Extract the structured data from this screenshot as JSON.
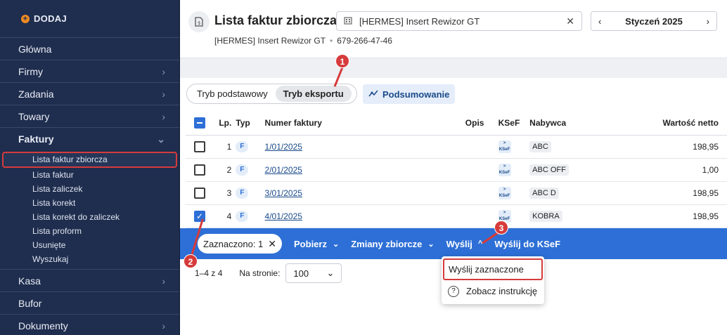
{
  "sidebar": {
    "add_label": "DODAJ",
    "items_top": [
      "Główna",
      "Firmy",
      "Zadania",
      "Towary"
    ],
    "open_item": "Faktury",
    "subitems": [
      "Lista faktur zbiorcza",
      "Lista faktur",
      "Lista zaliczek",
      "Lista korekt",
      "Lista korekt do zaliczek",
      "Lista proform",
      "Usunięte",
      "Wyszukaj"
    ],
    "items_bottom": [
      "Kasa",
      "Bufor",
      "Dokumenty"
    ]
  },
  "header": {
    "title": "Lista faktur zbiorcza",
    "company_name": "[HERMES] Insert Rewizor GT",
    "company_nip": "679-266-47-46",
    "company_select": "[HERMES] Insert Rewizor GT",
    "month": "Styczeń 2025"
  },
  "toolbar": {
    "mode_basic": "Tryb podstawowy",
    "mode_export": "Tryb eksportu",
    "summary": "Podsumowanie"
  },
  "table": {
    "headers": {
      "lp": "Lp.",
      "typ": "Typ",
      "numer": "Numer faktury",
      "opis": "Opis",
      "ksef": "KSeF",
      "nabywca": "Nabywca",
      "wartosc": "Wartość netto"
    },
    "rows": [
      {
        "lp": "1",
        "typ": "F",
        "numer": "1/01/2025",
        "nabywca": "ABC",
        "wartosc": "198,95",
        "checked": false
      },
      {
        "lp": "2",
        "typ": "F",
        "numer": "2/01/2025",
        "nabywca": "ABC OFF",
        "wartosc": "1,00",
        "checked": false
      },
      {
        "lp": "3",
        "typ": "F",
        "numer": "3/01/2025",
        "nabywca": "ABC D",
        "wartosc": "198,95",
        "checked": false
      },
      {
        "lp": "4",
        "typ": "F",
        "numer": "4/01/2025",
        "nabywca": "KOBRA",
        "wartosc": "198,95",
        "checked": true
      }
    ],
    "ksef_icon_label": "KSeF"
  },
  "action_bar": {
    "selected": "Zaznaczono: 1",
    "pobierz": "Pobierz",
    "zmiany": "Zmiany zbiorcze",
    "wyslij": "Wyślij",
    "wyslij_ksef": "Wyślij do KSeF"
  },
  "pager": {
    "range": "1–4 z 4",
    "per_page_label": "Na stronie:",
    "per_page": "100"
  },
  "dropdown": {
    "send_selected": "Wyślij zaznaczone",
    "instructions": "Zobacz instrukcję"
  },
  "markers": [
    "1",
    "2",
    "3"
  ],
  "colors": {
    "sidebar": "#1f2d4e",
    "accent": "#2d6fd6",
    "highlight": "#d63b3b",
    "brand": "#f08a24"
  }
}
